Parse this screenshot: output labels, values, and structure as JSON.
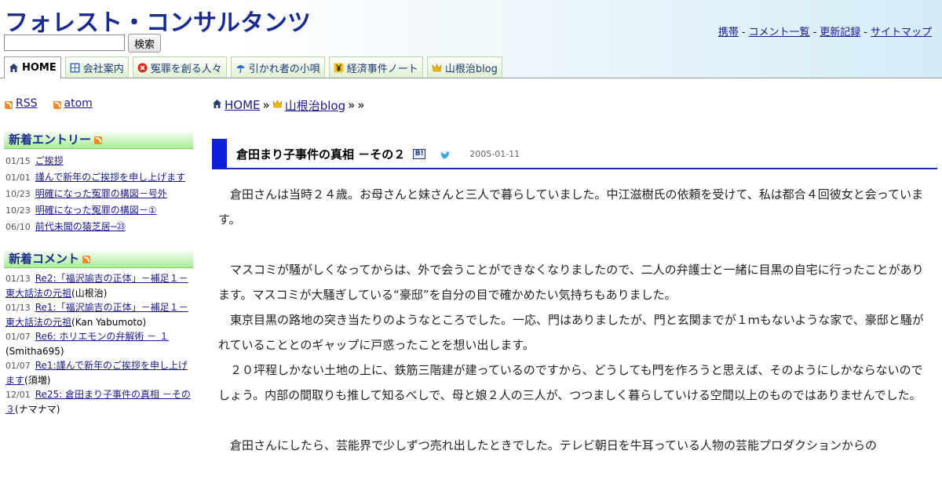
{
  "header": {
    "site_title": "フォレスト・コンサルタンツ",
    "search_placeholder": "",
    "search_button": "検索",
    "links": [
      "携帯",
      "コメント一覧",
      "更新記録",
      "サイトマップ"
    ],
    "separator": "-"
  },
  "tabs": [
    {
      "label": "HOME",
      "icon": "home-icon",
      "active": true
    },
    {
      "label": "会社案内",
      "icon": "grid-icon",
      "active": false
    },
    {
      "label": "冤罪を創る人々",
      "icon": "cross-circle-icon",
      "active": false
    },
    {
      "label": "引かれ者の小唄",
      "icon": "umbrella-icon",
      "active": false
    },
    {
      "label": "経済事件ノート",
      "icon": "yen-icon",
      "active": false
    },
    {
      "label": "山根治blog",
      "icon": "crown-icon",
      "active": false
    }
  ],
  "sidebar": {
    "feeds": [
      "RSS",
      "atom"
    ],
    "new_entries": {
      "heading": "新着エントリー",
      "items": [
        {
          "date": "01/15",
          "title": "ご挨拶"
        },
        {
          "date": "01/01",
          "title": "謹んで新年のご挨拶を申し上げます"
        },
        {
          "date": "10/23",
          "title": "明確になった冤罪の構図－号外"
        },
        {
          "date": "10/23",
          "title": "明確になった冤罪の構図－①"
        },
        {
          "date": "06/10",
          "title": "前代未聞の猿芝居─㉓"
        }
      ]
    },
    "new_comments": {
      "heading": "新着コメント",
      "items": [
        {
          "date": "01/13",
          "title": "Re2:「福沢諭吉の正体」－補足１－東大話法の元祖",
          "author": "(山根治)"
        },
        {
          "date": "01/13",
          "title": "Re1:「福沢諭吉の正体」－補足１－東大話法の元祖",
          "author": "(Kan Yabumoto)"
        },
        {
          "date": "01/07",
          "title": "Re6: ホリエモンの弁解術 － １",
          "author": "(Smitha695)"
        },
        {
          "date": "01/07",
          "title": "Re1:謹んで新年のご挨拶を申し上げます",
          "author": "(須増)"
        },
        {
          "date": "12/01",
          "title": "Re25: 倉田まり子事件の真相 －その３",
          "author": "(ナマナマ)"
        }
      ]
    }
  },
  "breadcrumb": {
    "home": "HOME",
    "sep1": "»",
    "blog": "山根治blog",
    "sep2": "»",
    "sep3": "»"
  },
  "post": {
    "title": "倉田まり子事件の真相 －その２",
    "hatena_label": "B!",
    "date": "2005-01-11",
    "paragraphs": [
      "倉田さんは当時２４歳。お母さんと妹さんと三人で暮らしていました。中江滋樹氏の依頼を受けて、私は都合４回彼女と会っています。",
      "マスコミが騒がしくなってからは、外で会うことができなくなりましたので、二人の弁護士と一緒に目黒の自宅に行ったことがあります。マスコミが大騒ぎしている“豪邸”を自分の目で確かめたい気持ちもありました。",
      "東京目黒の路地の突き当たりのようなところでした。一応、門はありましたが、門と玄関までが１ｍもないような家で、豪邸と騒がれていることとのギャップに戸惑ったことを想い出します。",
      "２０坪程しかない土地の上に、鉄筋三階建が建っているのですから、どうしても門を作ろうと思えば、そのようにしかならないのでしょう。内部の間取りも推して知るべしで、母と娘２人の三人が、つつましく暮らしていける空間以上のものではありませんでした。",
      "倉田さんにしたら、芸能界で少しずつ売れ出したときでした。テレビ朝日を牛耳っている人物の芸能プロダクションからの"
    ]
  },
  "colors": {
    "title": "#1a2b8f",
    "link": "#1a1a8c",
    "post_marker": "#0d1fd8",
    "sidebar_heading_bg": "#a8ec94",
    "rss": "#f08a24"
  }
}
